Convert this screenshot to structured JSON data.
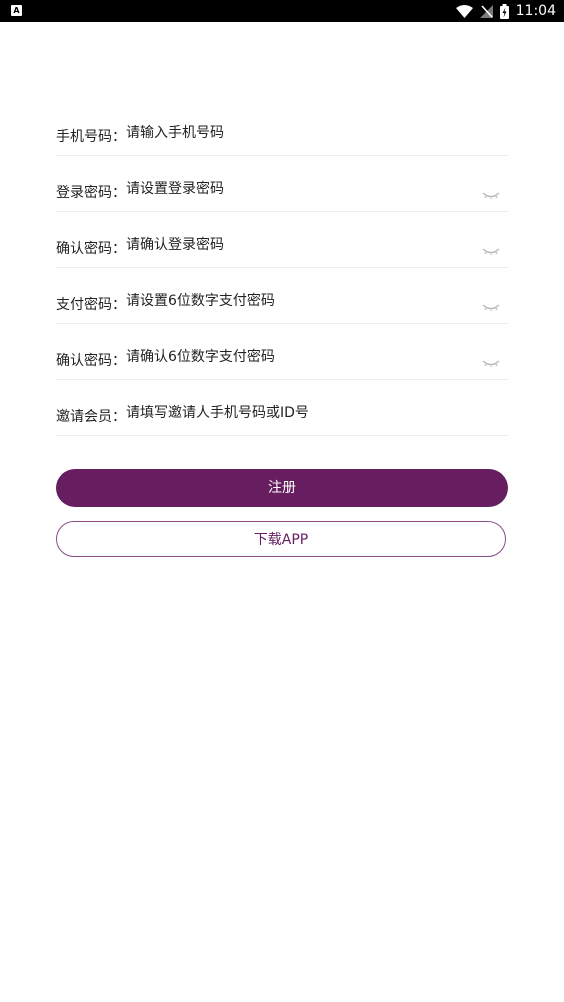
{
  "status_bar": {
    "app_icon": "A",
    "time": "11:04",
    "icons": [
      "wifi-icon",
      "no-signal-icon",
      "battery-charging-icon"
    ]
  },
  "form": {
    "phone": {
      "label": "手机号码：",
      "placeholder": "请输入手机号码"
    },
    "login_password": {
      "label": "登录密码：",
      "placeholder": "请设置登录密码"
    },
    "confirm_login_password": {
      "label": "确认密码：",
      "placeholder": "请确认登录密码"
    },
    "pay_password": {
      "label": "支付密码：",
      "placeholder": "请设置6位数字支付密码"
    },
    "confirm_pay_password": {
      "label": "确认密码：",
      "placeholder": "请确认6位数字支付密码"
    },
    "invite": {
      "label": "邀请会员：",
      "placeholder": "请填写邀请人手机号码或ID号"
    }
  },
  "buttons": {
    "register": "注册",
    "download": "下载APP"
  },
  "colors": {
    "accent": "#661e60",
    "divider": "#ececec",
    "status_bar": "#000000"
  }
}
